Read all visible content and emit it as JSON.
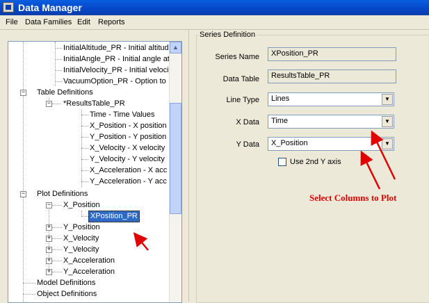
{
  "window": {
    "title": "Data Manager"
  },
  "menu": {
    "file": "File",
    "data_families": "Data Families",
    "edit": "Edit",
    "reports": "Reports"
  },
  "tree": {
    "nodes": [
      "InitialAltitude_PR  -  Initial altitude",
      "InitialAngle_PR  -  Initial angle at",
      "InitialVelocity_PR  -  Initial veloci",
      "VacuumOption_PR  -  Option to",
      "Table Definitions",
      "*ResultsTable_PR",
      "Time  -  Time Values",
      "X_Position  -  X position",
      "Y_Position  -  Y position",
      "X_Velocity  -  X velocity",
      "Y_Velocity  -  Y velocity",
      "X_Acceleration  -  X acc",
      "Y_Acceleration  -  Y acc",
      "Plot Definitions",
      "X_Position",
      "XPosition_PR",
      "Y_Position",
      "X_Velocity",
      "Y_Velocity",
      "X_Acceleration",
      "Y_Acceleration",
      "Model Definitions",
      "Object Definitions"
    ]
  },
  "series_definition": {
    "group_title": "Series Definition",
    "series_name_label": "Series Name",
    "series_name_value": "XPosition_PR",
    "data_table_label": "Data Table",
    "data_table_value": "ResultsTable_PR",
    "line_type_label": "Line Type",
    "line_type_value": "Lines",
    "x_data_label": "X Data",
    "x_data_value": "Time",
    "y_data_label": "Y Data",
    "y_data_value": "X_Position",
    "second_y_axis_label": "Use 2nd Y axis",
    "second_y_axis_checked": false
  },
  "annotation": {
    "text": "Select Columns to Plot",
    "color": "#e00000"
  }
}
